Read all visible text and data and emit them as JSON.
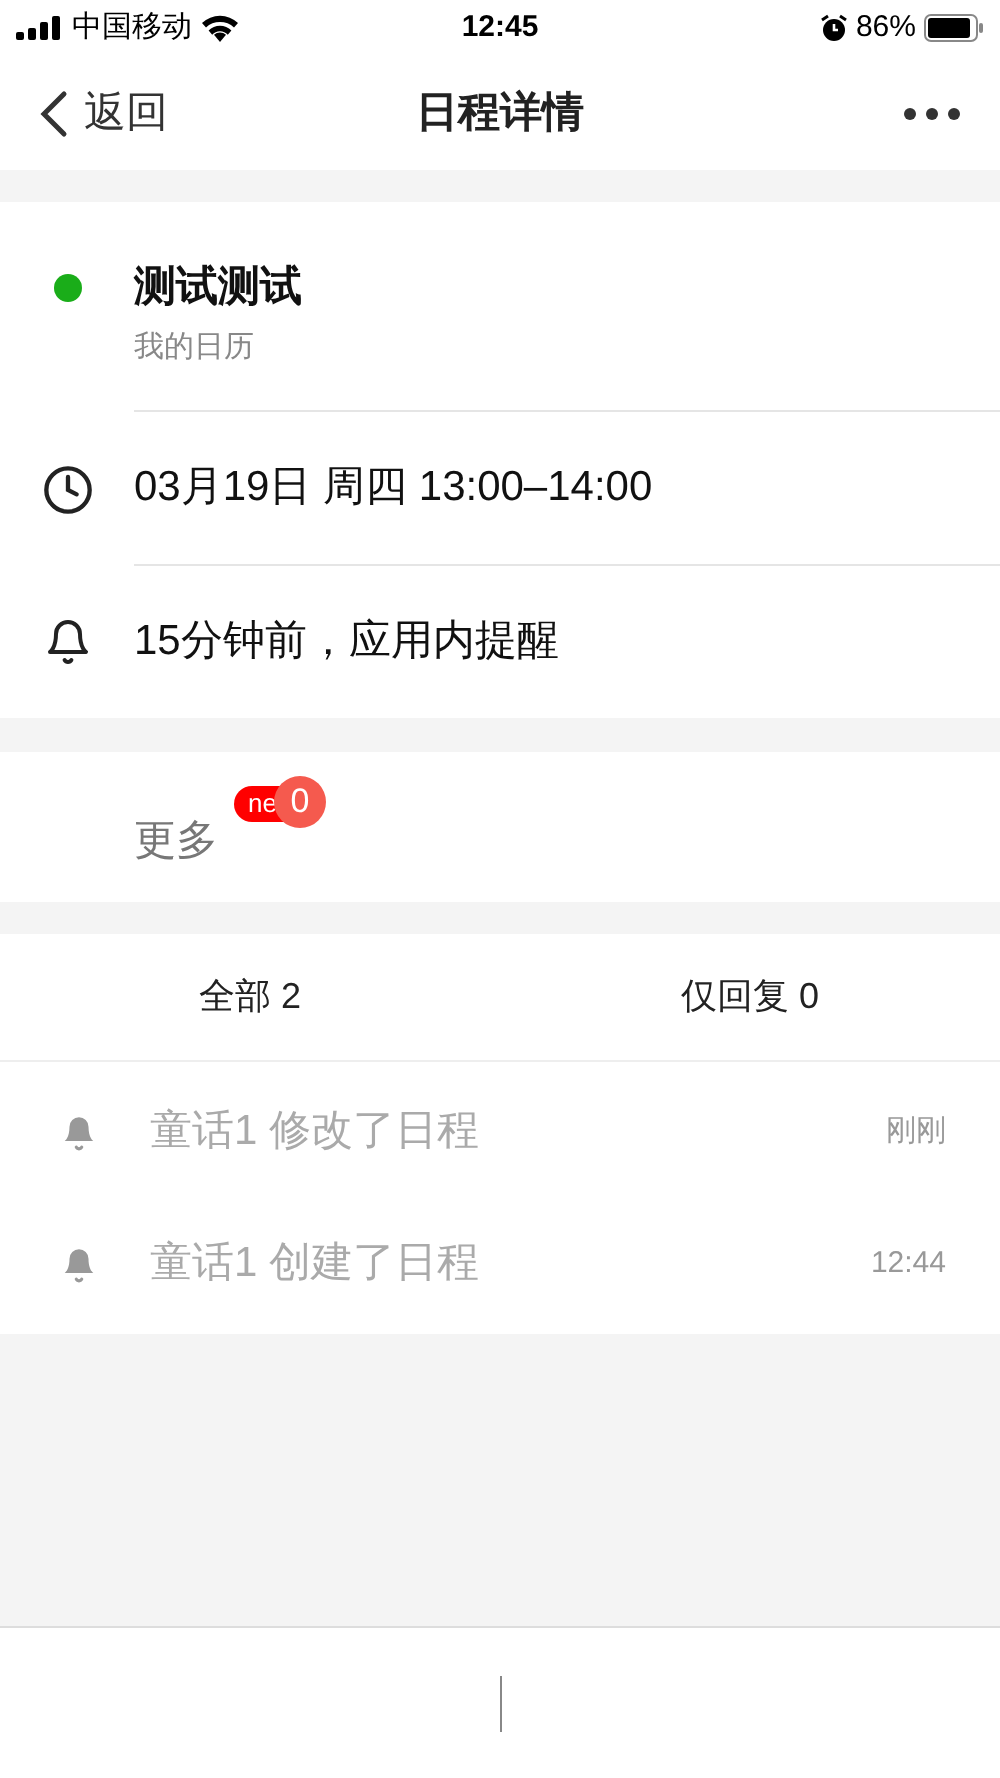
{
  "status_bar": {
    "carrier": "中国移动",
    "time": "12:45",
    "battery": "86%"
  },
  "nav": {
    "back": "返回",
    "title": "日程详情"
  },
  "event": {
    "title": "测试测试",
    "calendar": "我的日历",
    "color": "#1aad19",
    "time": "03月19日 周四 13:00–14:00",
    "reminder": "15分钟前，应用内提醒"
  },
  "more": {
    "label": "更多",
    "new_badge": "ne",
    "count": "0"
  },
  "tabs": [
    {
      "label": "全部 2"
    },
    {
      "label": "仅回复 0"
    }
  ],
  "activity": [
    {
      "text": "童话1 修改了日程",
      "time": "刚刚"
    },
    {
      "text": "童话1 创建了日程",
      "time": "12:44"
    }
  ]
}
